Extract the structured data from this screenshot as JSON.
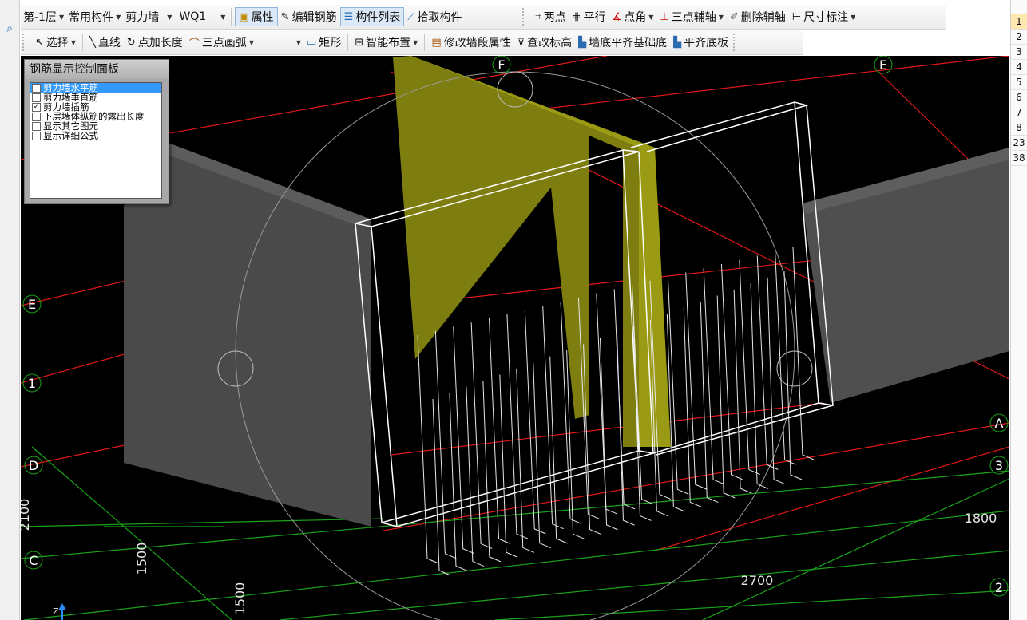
{
  "toolbar1": {
    "floor": "第-1层",
    "category": "常用构件",
    "type": "剪力墙",
    "name": "WQ1",
    "property": "属性",
    "edit_rebar": "编辑钢筋",
    "component_list": "构件列表",
    "pick_component": "拾取构件",
    "two_points": "两点",
    "parallel": "平行",
    "point_angle": "点角",
    "three_point_axis": "三点辅轴",
    "delete_axis": "删除辅轴",
    "dimension": "尺寸标注"
  },
  "toolbar2": {
    "select": "选择",
    "line": "直线",
    "point_length": "点加长度",
    "three_point_arc": "三点画弧",
    "rectangle": "矩形",
    "smart_layout": "智能布置",
    "modify_wall_segment": "修改墙段属性",
    "check_elevation": "查改标高",
    "align_base": "墙底平齐基础底",
    "align_slab": "平齐底板"
  },
  "panel": {
    "title": "钢筋显示控制面板",
    "items": [
      {
        "label": "剪力墙水平筋",
        "checked": false,
        "highlighted": true
      },
      {
        "label": "剪力墙垂直筋",
        "checked": false,
        "highlighted": false
      },
      {
        "label": "剪力墙插筋",
        "checked": true,
        "highlighted": false
      },
      {
        "label": "下层墙体纵筋的露出长度",
        "checked": false,
        "highlighted": false
      },
      {
        "label": "显示其它图元",
        "checked": false,
        "highlighted": false
      },
      {
        "label": "显示详细公式",
        "checked": false,
        "highlighted": false
      }
    ]
  },
  "right_list": [
    "1",
    "2",
    "3",
    "4",
    "5",
    "6",
    "7",
    "8",
    "23",
    "38"
  ],
  "axis_labels": {
    "F": "F",
    "E_top": "E",
    "E_left": "E",
    "one": "1",
    "D": "D",
    "C": "C",
    "A": "A",
    "three": "3",
    "two": "2"
  },
  "dimensions": {
    "d2100": "2100",
    "d1500a": "1500",
    "d1500b": "1500",
    "d2700": "2700",
    "d1800": "1800"
  },
  "axis_indicator": "Z",
  "colors": {
    "viewport_bg": "#000000",
    "grid_red": "#e01818",
    "grid_green": "#1aa31a",
    "wall_gray": "#4d4d4d",
    "wall_yellow": "#8a8a12",
    "rebar_white": "#ffffff",
    "highlight": "#3399ff"
  }
}
